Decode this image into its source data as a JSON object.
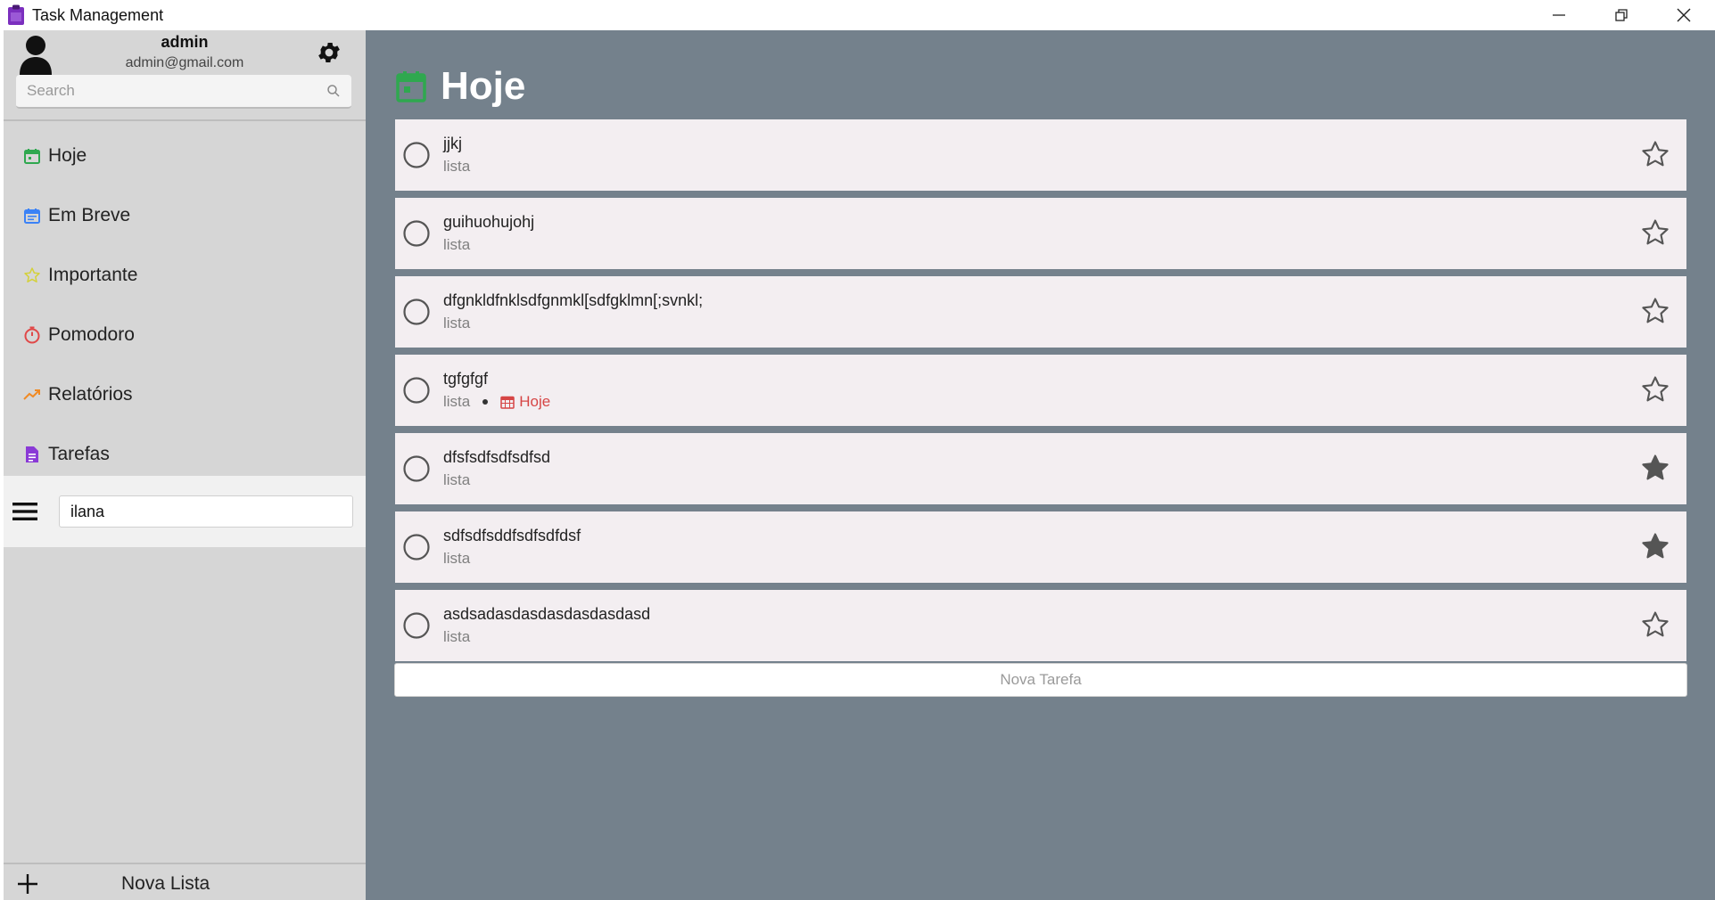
{
  "window": {
    "title": "Task Management"
  },
  "sidebar": {
    "user_name": "admin",
    "user_email": "admin@gmail.com",
    "search_placeholder": "Search",
    "nav": [
      {
        "label": "Hoje",
        "icon": "calendar-icon",
        "color": "#2fa84f"
      },
      {
        "label": "Em Breve",
        "icon": "calendar-list-icon",
        "color": "#3b82f6"
      },
      {
        "label": "Importante",
        "icon": "star-outline-icon",
        "color": "#d4d13a"
      },
      {
        "label": "Pomodoro",
        "icon": "timer-icon",
        "color": "#e04848"
      },
      {
        "label": "Relatórios",
        "icon": "trend-chart-icon",
        "color": "#f08a24"
      },
      {
        "label": "Tarefas",
        "icon": "document-icon",
        "color": "#8a3ad6"
      }
    ],
    "list_name_value": "ilana",
    "new_list_label": "Nova Lista"
  },
  "main": {
    "title": "Hoje",
    "tasks": [
      {
        "title": "jjkj",
        "list": "lista",
        "due": "",
        "starred": false
      },
      {
        "title": "guihuohujohj",
        "list": "lista",
        "due": "",
        "starred": false
      },
      {
        "title": "dfgnkldfnklsdfgnmkl[sdfgklmn[;svnkl;",
        "list": "lista",
        "due": "",
        "starred": false
      },
      {
        "title": "tgfgfgf",
        "list": "lista",
        "due": "Hoje",
        "starred": false
      },
      {
        "title": "dfsfsdfsdfsdfsd",
        "list": "lista",
        "due": "",
        "starred": true
      },
      {
        "title": "sdfsdfsddfsdfsdfdsf",
        "list": "lista",
        "due": "",
        "starred": true
      },
      {
        "title": "asdsadasdasdasdasdasdasd",
        "list": "lista",
        "due": "",
        "starred": false
      }
    ],
    "new_task_label": "Nova Tarefa"
  },
  "colors": {
    "accent_today": "#2fa84f",
    "main_background": "#74818c",
    "sidebar_background": "#d6d6d6",
    "due_red": "#d64545"
  }
}
